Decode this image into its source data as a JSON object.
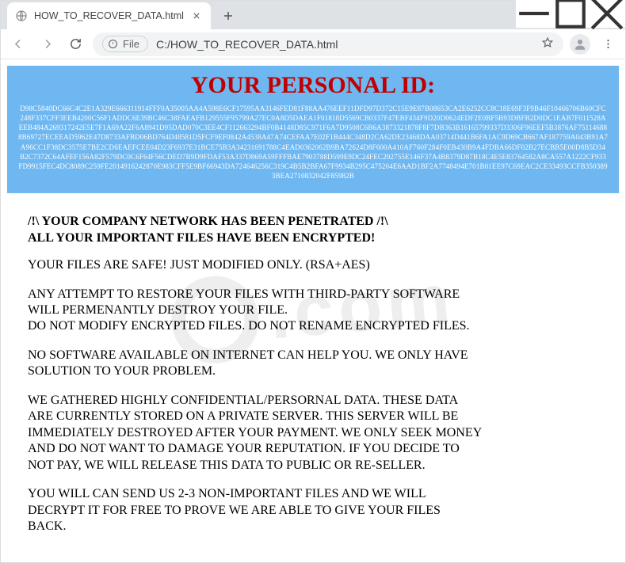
{
  "window": {
    "tab_title": "HOW_TO_RECOVER_DATA.html"
  },
  "toolbar": {
    "file_chip_label": "File",
    "url": "C:/HOW_TO_RECOVER_DATA.html"
  },
  "page": {
    "heading": "YOUR PERSONAL ID:",
    "personal_id": "D98C5840DC66C4C2E1A329E666311914FFF0A35005AA4A598E6CF17595AA3146FED81F88AA476EEF11DFD97D372C15E9E87B08653CA2E6252CC8C18E69F3F9B46F10466706B60CFC248F337CFF3EEB4200C56F1ADDC6E39BC46C38FAEAFB129555F95799A27EC0A8D5DAEA1F01818D5569CB0337F47EBF434F9D20D0624EDF2E0BF5B93DBFB2D0DC1EAB7F011528AEEB484A269317242E5E7F1A69A22F6A8941D95DAD070C3EE4CF112663294BF0B4148D85C971F6A7D9508C6B6A3873321878F8F7DB363B16165799337D3306F96EEF5B3876AF751146888B69727ECEEAD5962E47D8733AFBD06BD764D48581D5FCF9EF0842A4538A47A74CEFAA7E02F1B444C348D2CA62DE23468DAA03714D441B6FA1AC9D69CB667AF187759A043B91A7A96CC1F38DC3575E7BE2CD6EAEFCEE04D23F6937E31BCE75B3A34231691788C4EAD0362062B9BA72624D8F600A410AF760F284F0EB430B9A4FDBA66DF02B27ECBB5E00D8B5D34B2C7372C64AFEF156A82F579DC0C6F64F56CDED7B9D9FDAF53A337D869A59FFFBAE7903788D599E9DC24FEC202755E146F37A4B8379D87B18C4E5E83764582A8CA557A1222CF933FD9915FEC4DC8089C259FE2014916242870E983CFF5E9BF66943DA724646256C319C4B5B2BFA67F9934B295C475204E6AAD1BF2A7748494E701B01EE97C69EAC2CE33493CCFB3503893BEA2710832042F85982B",
    "paragraphs": {
      "p1": "/!\\ YOUR COMPANY NETWORK HAS BEEN PENETRATED /!\\\nALL YOUR IMPORTANT FILES HAVE BEEN ENCRYPTED!",
      "p2": "YOUR FILES ARE SAFE! JUST MODIFIED ONLY. (RSA+AES)",
      "p3": "ANY ATTEMPT TO RESTORE YOUR FILES WITH THIRD-PARTY SOFTWARE\nWILL PERMENANTLY DESTROY YOUR FILE.\nDO NOT MODIFY ENCRYPTED FILES. DO NOT RENAME ENCRYPTED FILES.",
      "p4": "NO SOFTWARE AVAILABLE ON INTERNET CAN HELP YOU. WE ONLY HAVE\nSOLUTION TO YOUR PROBLEM.",
      "p5": "WE GATHERED HIGHLY CONFIDENTIAL/PERSORNAL DATA. THESE DATA\nARE CURRENTLY STORED ON A PRIVATE SERVER. THIS SERVER WILL BE\nIMMEDIATELY DESTROYED AFTER YOUR PAYMENT. WE ONLY SEEK MONEY\nAND DO NOT WANT TO DAMAGE YOUR REPUTATION. IF YOU DECIDE TO\nNOT PAY, WE WILL RELEASE THIS DATA TO PUBLIC OR RE-SELLER.",
      "p6": "YOU WILL CAN SEND US 2-3 NON-IMPORTANT FILES AND WE WILL\nDECRYPT IT FOR FREE TO PROVE WE ARE ABLE TO GIVE YOUR FILES\nBACK."
    }
  }
}
